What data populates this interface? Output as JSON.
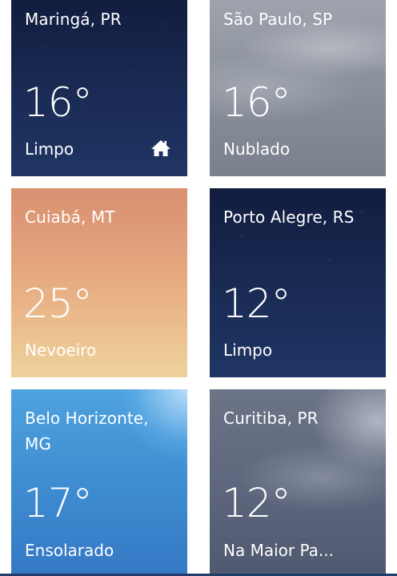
{
  "tiles": [
    {
      "city": "Maringá, PR",
      "temperature": "16°",
      "condition": "Limpo",
      "background": "#1a2b55",
      "home_icon": "home-icon"
    },
    {
      "city": "São Paulo, SP",
      "temperature": "16°",
      "condition": "Nublado",
      "background": "#8a909b"
    },
    {
      "city": "Cuiabá, MT",
      "temperature": "25°",
      "condition": "Nevoeiro",
      "background": "#e6a87f"
    },
    {
      "city": "Porto Alegre, RS",
      "temperature": "12°",
      "condition": "Limpo",
      "background": "#1a2b55"
    },
    {
      "city": "Belo Horizonte, MG",
      "temperature": "17°",
      "condition": "Ensolarado",
      "background": "#3e8bd0"
    },
    {
      "city": "Curitiba, PR",
      "temperature": "12°",
      "condition": "Na Maior Pa...",
      "background": "#5e677d"
    }
  ]
}
